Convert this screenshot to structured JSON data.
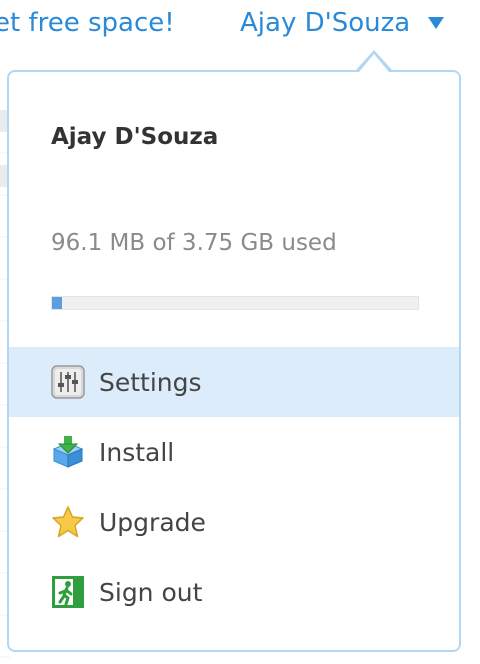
{
  "header": {
    "free_space_link": "et free space!",
    "user_name": "Ajay D'Souza"
  },
  "dropdown": {
    "display_name": "Ajay D'Souza",
    "quota_text": "96.1 MB of 3.75 GB used",
    "quota_used_fraction": 0.025,
    "items": [
      {
        "label": "Settings",
        "icon": "settings-sliders-icon",
        "highlighted": true
      },
      {
        "label": "Install",
        "icon": "install-box-icon",
        "highlighted": false
      },
      {
        "label": "Upgrade",
        "icon": "star-icon",
        "highlighted": false
      },
      {
        "label": "Sign out",
        "icon": "exit-door-icon",
        "highlighted": false
      }
    ]
  },
  "colors": {
    "link_blue": "#2a8ad8",
    "menu_border": "#b3d7f3",
    "highlight_bg": "#dcecfb",
    "quota_fill": "#5aa0e0",
    "star_yellow": "#f7c948",
    "signout_green": "#2e9e3e"
  }
}
